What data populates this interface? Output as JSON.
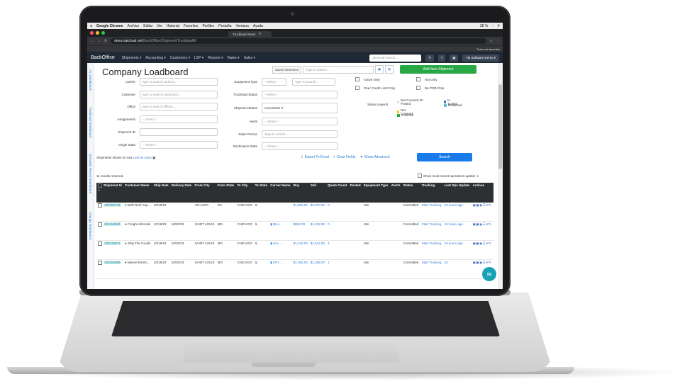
{
  "macos": {
    "app": "Google Chrome",
    "menus": [
      "Archivo",
      "Editar",
      "Ver",
      "Historial",
      "Favoritos",
      "Perfiles",
      "Pestaña",
      "Ventana",
      "Ayuda"
    ],
    "status": "38 %"
  },
  "browser": {
    "tab_title": "Truckload Searc",
    "url_host": "demo.taicloud.net",
    "url_path": "/BackOffice/Shipment/TruckloadW",
    "bookmark": "Todos los favoritos"
  },
  "nav": {
    "brand": "BackOffice",
    "items": [
      "Shipments ▾",
      "Accounting ▾",
      "Customers ▾",
      "LSP ▾",
      "Reports ▾",
      "Rates ▾",
      "Sales ▾"
    ],
    "search_placeholder": "universal search...",
    "account": "Tai Software Demo ▾"
  },
  "sidebar": {
    "tabs": [
      "LTL Dashboard",
      "Truckload Dashboard",
      "Domestic Parcel Dashboard",
      "Change Dashboard"
    ]
  },
  "page": {
    "title": "Company Loadboard",
    "saved_searches": "Saved Searches",
    "saved_placeholder": "Type to search...",
    "add_new": "Add New Shipment"
  },
  "filters": {
    "carrier": {
      "label": "Carrier",
      "placeholder": "type to search carriers..."
    },
    "customer": {
      "label": "Customer",
      "placeholder": "type to search customers..."
    },
    "office": {
      "label": "Office",
      "placeholder": "type to search offices..."
    },
    "assignments": {
      "label": "Assignments",
      "value": "-- Select --"
    },
    "shipment_id": {
      "label": "Shipment ID",
      "value": ""
    },
    "origin_state": {
      "label": "Origin State",
      "value": "-- Select --"
    },
    "equipment_type": {
      "label": "Equipment Type",
      "value": "--Select--",
      "placeholder": "Type to search..."
    },
    "truckload_status": {
      "label": "Truckload Status",
      "value": "--Select--"
    },
    "shipment_status": {
      "label": "Shipment Status",
      "value": "Committed ✕"
    },
    "alerts": {
      "label": "Alerts",
      "value": "-- Select --"
    },
    "sales_person": {
      "label": "Sales Person",
      "placeholder": "Type to search..."
    },
    "destination_state": {
      "label": "Destination State",
      "value": "-- Select --"
    }
  },
  "checks": [
    "Active Only",
    "Over Credit Limit Only",
    "Hot Only",
    "No POD Only"
  ],
  "legend": {
    "title": "Status Legend",
    "items": [
      {
        "label": "Not Covered Or Posted",
        "color": "#e0e0e0"
      },
      {
        "label": "Not Covered",
        "color": "#f5c518"
      },
      {
        "label": "Covered",
        "color": "#28a745"
      },
      {
        "label": "In Transit",
        "color": "#2b7bd6"
      },
      {
        "label": "Delivered",
        "color": "#5bc0de"
      }
    ]
  },
  "footer": {
    "shown_prefix": "Shipments shown for last",
    "shown_link": "Last 90 Days",
    "export": "Export To Excel",
    "clear": "Clear Fields",
    "advanced": "Show Advanced",
    "search": "Search",
    "results": "11 results returned.",
    "show_recent": "Show most recent operations update"
  },
  "table": {
    "headers": [
      "Shipment Id",
      "Customer Name",
      "Ship Date",
      "Delivery Date",
      "From City",
      "From State",
      "To City",
      "To State",
      "Carrier Name",
      "Buy",
      "Sell",
      "Quote Count",
      "Posted",
      "Equipment Type",
      "Alerts",
      "Status",
      "Tracking",
      "Last Ops Update",
      "Actions"
    ],
    "rows": [
      {
        "id": "100154745",
        "customer": "Bulk Reef Sup...",
        "ship": "10/19/23",
        "delivery": "",
        "from_city": "ATLANTA",
        "from_state": "GA",
        "to_city": "CHICAGO",
        "to_state": "IL",
        "carrier": "",
        "buy": "$1,800.00",
        "sell": "$2,070.00",
        "quote": "0",
        "posted": "",
        "equip": "Van",
        "alerts": "",
        "status": "Committed",
        "tracking": "Start Tracking",
        "last": "10 hours ago"
      },
      {
        "id": "100154524",
        "customer": "Freight all Kinds",
        "ship": "10/19/23",
        "delivery": "10/20/23",
        "from_city": "SAINT LOUIS",
        "from_state": "MO",
        "to_city": "CHICAGO",
        "to_state": "IL",
        "carrier": "BILL...",
        "buy": "$852.00",
        "sell": "$1,232.00",
        "quote": "0",
        "posted": "",
        "equip": "Van",
        "alerts": "",
        "status": "Committed",
        "tracking": "Start Tracking",
        "last": "10 hours ago"
      },
      {
        "id": "100134971",
        "customer": "Ship The Goods",
        "ship": "10/19/23",
        "delivery": "10/20/23",
        "from_city": "SAINT LOUIS",
        "from_state": "MO",
        "to_city": "CHICAGO",
        "to_state": "IL",
        "carrier": "SAL...",
        "buy": "$1,232.00",
        "sell": "$1,512.00",
        "quote": "4",
        "posted": "",
        "equip": "Van",
        "alerts": "",
        "status": "Committed",
        "tracking": "Start Tracking",
        "last": "10 hours ago"
      },
      {
        "id": "100154999",
        "customer": "Marvel Entert...",
        "ship": "10/19/23",
        "delivery": "10/20/23",
        "from_city": "SAINT LOUIS",
        "from_state": "MO",
        "to_city": "CHICAGO",
        "to_state": "IL",
        "carrier": "ATH...",
        "buy": "$1,064.00",
        "sell": "$1,288.00",
        "quote": "1",
        "posted": "",
        "equip": "Van",
        "alerts": "",
        "status": "Committed",
        "tracking": "Start Tracking",
        "last": "10"
      }
    ]
  },
  "colors": {
    "nav": "#1f2935",
    "add": "#28a745",
    "search": "#1a7bea",
    "link": "#2b7bd6"
  }
}
